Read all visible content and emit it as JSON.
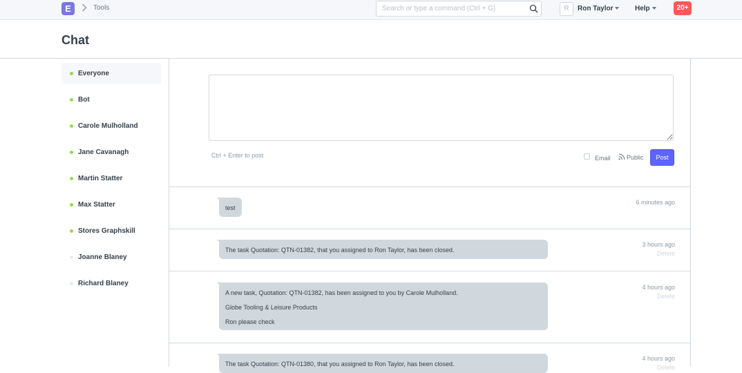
{
  "navbar": {
    "logo_letter": "E",
    "breadcrumb": "Tools",
    "search_placeholder": "Search or type a command (Ctrl + G)",
    "avatar_letter": "R",
    "user_name": "Ron Taylor",
    "help_label": "Help",
    "notifications": "20+"
  },
  "page": {
    "title": "Chat"
  },
  "sidebar": {
    "items": [
      {
        "label": "Everyone",
        "status": "online",
        "active": true
      },
      {
        "label": "Bot",
        "status": "online"
      },
      {
        "label": "Carole Mulholland",
        "status": "online"
      },
      {
        "label": "Jane Cavanagh",
        "status": "online"
      },
      {
        "label": "Martin Statter",
        "status": "online"
      },
      {
        "label": "Max Statter",
        "status": "online"
      },
      {
        "label": "Stores Graphskill",
        "status": "online"
      },
      {
        "label": "Joanne Blaney",
        "status": "offline"
      },
      {
        "label": "Richard Blaney",
        "status": "offline"
      }
    ],
    "colors": {
      "online": "#98d85b",
      "offline": "#e8edf1"
    }
  },
  "composer": {
    "hint": "Ctrl + Enter to post",
    "email_label": "Email",
    "public_label": "Public",
    "post_label": "Post"
  },
  "feed": [
    {
      "lines": [
        "test"
      ],
      "time": "6 minutes ago",
      "delete": ""
    },
    {
      "lines": [
        "The task Quotation: QTN-01382, that you assigned to Ron Taylor, has been closed."
      ],
      "time": "3 hours ago",
      "delete": "Delete"
    },
    {
      "lines": [
        "A new task, Quotation: QTN-01382, has been assigned to you by Carole Mulholland.",
        "Globe Tooling & Leisure Products",
        "Ron please check"
      ],
      "time": "4 hours ago",
      "delete": "Delete"
    },
    {
      "lines": [
        "The task Quotation: QTN-01380, that you assigned to Ron Taylor, has been closed."
      ],
      "time": "4 hours ago",
      "delete": "Delete"
    }
  ],
  "colors": {
    "accent": "#5e64ff",
    "badge": "#ff5858",
    "logo": "#7c75e8"
  }
}
